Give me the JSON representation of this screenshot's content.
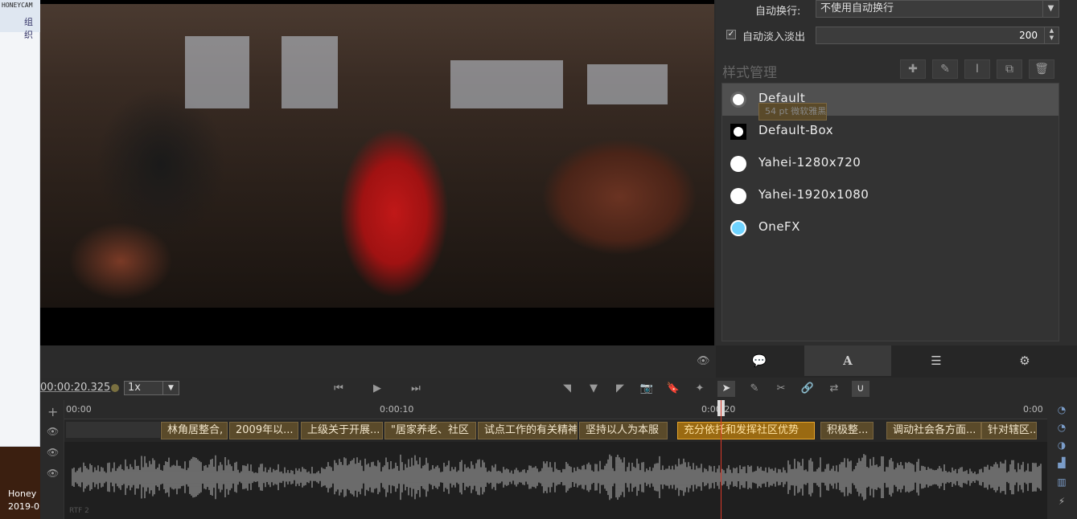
{
  "desktop": {
    "watermark": "HONEYCAM",
    "org_label": "组织",
    "taskbar_line1": "Honey",
    "taskbar_line2": "2019-0"
  },
  "video": {
    "eye_icon": "eye-icon"
  },
  "right_panel": {
    "wrap_label": "自动换行:",
    "wrap_value": "不使用自动换行",
    "fade_label": "自动淡入淡出",
    "fade_checked": true,
    "fade_value": "200",
    "style_mgmt_title": "样式管理",
    "toolbar": {
      "add_icon": "plus-icon",
      "edit_icon": "pencil-icon",
      "text_icon": "text-cursor-icon",
      "copy_icon": "copy-icon",
      "delete_icon": "trash-icon"
    },
    "styles": [
      {
        "name": "Default",
        "sub": "54 pt 微软雅黑",
        "selected": true,
        "swatch": "#ffffff"
      },
      {
        "name": "Default-Box",
        "sub": "",
        "selected": false,
        "swatch": "#ffffff"
      },
      {
        "name": "Yahei-1280x720",
        "sub": "",
        "selected": false,
        "swatch": "#ffffff"
      },
      {
        "name": "Yahei-1920x1080",
        "sub": "",
        "selected": false,
        "swatch": "#ffffff"
      },
      {
        "name": "OneFX",
        "sub": "",
        "selected": false,
        "swatch": "#6fd3ff"
      }
    ],
    "tabs": [
      {
        "icon": "chat-bubble-icon",
        "glyph": "💬"
      },
      {
        "icon": "font-a-icon",
        "glyph": "A"
      },
      {
        "icon": "list-icon",
        "glyph": "☰"
      },
      {
        "icon": "gear-icon",
        "glyph": "⚙"
      }
    ]
  },
  "transport": {
    "timecode": "00:00:20.325",
    "speed": "1x"
  },
  "timeline": {
    "ruler_ticks": [
      "00:00",
      "0:00:10",
      "0:00:20",
      "0:00"
    ],
    "subtitles": [
      {
        "text": "林角居整合,",
        "selected": false
      },
      {
        "text": "2009年以...",
        "selected": false
      },
      {
        "text": "上级关于开展...",
        "selected": false
      },
      {
        "text": "\"居家养老、社区",
        "selected": false
      },
      {
        "text": "试点工作的有关精神",
        "selected": false
      },
      {
        "text": "坚持以人为本服",
        "selected": false
      },
      {
        "text": "充分依托和发挥社区优势",
        "selected": true
      },
      {
        "text": "积极整...",
        "selected": false
      },
      {
        "text": "调动社会各方面...",
        "selected": false
      },
      {
        "text": "针对辖区...",
        "selected": false
      }
    ],
    "track_name": "RTF 2"
  },
  "colors": {
    "accent_selected_sub": "#e6a52c",
    "playhead": "#d93a2a",
    "onefx_swatch": "#6fd3ff"
  }
}
